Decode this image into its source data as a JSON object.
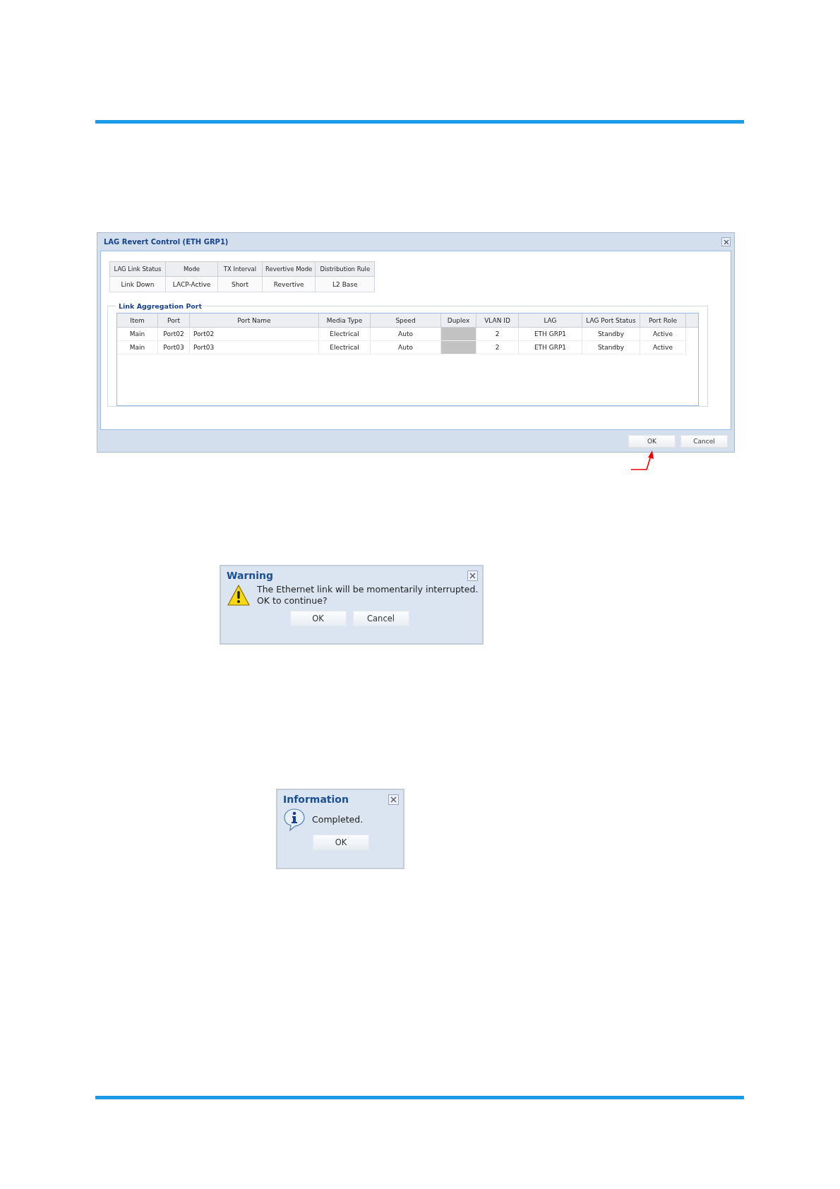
{
  "lag_dialog": {
    "title": "LAG Revert Control (ETH GRP1)",
    "summary": {
      "columns": [
        "LAG Link Status",
        "Mode",
        "TX Interval",
        "Revertive Mode",
        "Distribution Rule"
      ],
      "values": [
        "Link Down",
        "LACP-Active",
        "Short",
        "Revertive",
        "L2 Base"
      ]
    },
    "port_group": {
      "title": "Link Aggregation Port",
      "columns": [
        "Item",
        "Port",
        "Port Name",
        "Media Type",
        "Speed",
        "Duplex",
        "VLAN ID",
        "LAG",
        "LAG Port Status",
        "Port Role"
      ],
      "rows": [
        {
          "item": "Main",
          "port": "Port02",
          "port_name": "Port02",
          "media_type": "Electrical",
          "speed": "Auto",
          "duplex_disabled": true,
          "vlan_id": "2",
          "lag": "ETH GRP1",
          "lag_port_status": "Standby",
          "port_role": "Active"
        },
        {
          "item": "Main",
          "port": "Port03",
          "port_name": "Port03",
          "media_type": "Electrical",
          "speed": "Auto",
          "duplex_disabled": true,
          "vlan_id": "2",
          "lag": "ETH GRP1",
          "lag_port_status": "Standby",
          "port_role": "Active"
        }
      ]
    },
    "buttons": [
      "OK",
      "Cancel"
    ]
  },
  "warning_dialog": {
    "title": "Warning",
    "message": [
      "The Ethernet link will be momentarily interrupted.",
      "OK to continue?"
    ],
    "buttons": [
      "OK",
      "Cancel"
    ]
  },
  "info_dialog": {
    "title": "Information",
    "message": "Completed.",
    "buttons": [
      "OK"
    ]
  }
}
